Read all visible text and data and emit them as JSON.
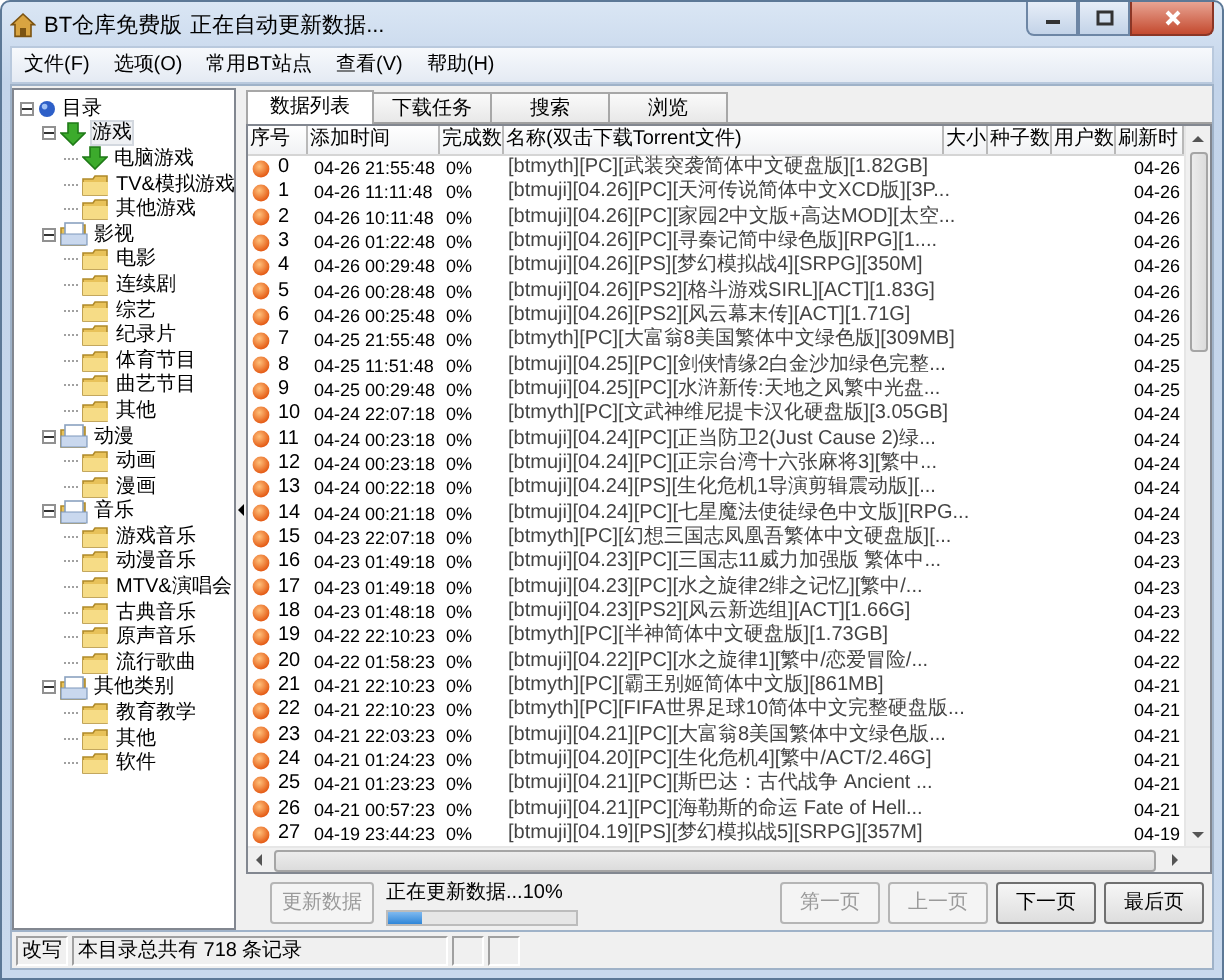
{
  "window": {
    "title": "BT仓库免费版",
    "subtitle": "正在自动更新数据..."
  },
  "menu": [
    {
      "label": "文件(F)"
    },
    {
      "label": "选项(O)"
    },
    {
      "label": "常用BT站点"
    },
    {
      "label": "查看(V)"
    },
    {
      "label": "帮助(H)"
    }
  ],
  "tree": {
    "label": "目录",
    "kind": "root",
    "expanded": true,
    "selected": false,
    "children": [
      {
        "label": "游戏",
        "kind": "download",
        "expanded": true,
        "selected": true,
        "children": [
          {
            "label": "电脑游戏",
            "kind": "download",
            "selected": false
          },
          {
            "label": "TV&模拟游戏",
            "kind": "folder",
            "selected": false
          },
          {
            "label": "其他游戏",
            "kind": "folder",
            "selected": false
          }
        ]
      },
      {
        "label": "影视",
        "kind": "category",
        "expanded": true,
        "selected": false,
        "children": [
          {
            "label": "电影",
            "kind": "folder",
            "selected": false
          },
          {
            "label": "连续剧",
            "kind": "folder",
            "selected": false
          },
          {
            "label": "综艺",
            "kind": "folder",
            "selected": false
          },
          {
            "label": "纪录片",
            "kind": "folder",
            "selected": false
          },
          {
            "label": "体育节目",
            "kind": "folder",
            "selected": false
          },
          {
            "label": "曲艺节目",
            "kind": "folder",
            "selected": false
          },
          {
            "label": "其他",
            "kind": "folder",
            "selected": false
          }
        ]
      },
      {
        "label": "动漫",
        "kind": "category",
        "expanded": true,
        "selected": false,
        "children": [
          {
            "label": "动画",
            "kind": "folder",
            "selected": false
          },
          {
            "label": "漫画",
            "kind": "folder",
            "selected": false
          }
        ]
      },
      {
        "label": "音乐",
        "kind": "category",
        "expanded": true,
        "selected": false,
        "children": [
          {
            "label": "游戏音乐",
            "kind": "folder",
            "selected": false
          },
          {
            "label": "动漫音乐",
            "kind": "folder",
            "selected": false
          },
          {
            "label": "MTV&演唱会",
            "kind": "folder",
            "selected": false
          },
          {
            "label": "古典音乐",
            "kind": "folder",
            "selected": false
          },
          {
            "label": "原声音乐",
            "kind": "folder",
            "selected": false
          },
          {
            "label": "流行歌曲",
            "kind": "folder",
            "selected": false
          }
        ]
      },
      {
        "label": "其他类别",
        "kind": "category",
        "expanded": true,
        "selected": false,
        "children": [
          {
            "label": "教育教学",
            "kind": "folder",
            "selected": false
          },
          {
            "label": "其他",
            "kind": "folder",
            "selected": false
          },
          {
            "label": "软件",
            "kind": "folder",
            "selected": false
          }
        ]
      }
    ]
  },
  "tabs": [
    {
      "label": "数据列表",
      "selected": true
    },
    {
      "label": "下载任务",
      "selected": false
    },
    {
      "label": "搜索",
      "selected": false
    },
    {
      "label": "浏览",
      "selected": false
    }
  ],
  "table": {
    "columns": [
      "序号",
      "添加时间",
      "完成数",
      "名称(双击下载Torrent文件)",
      "大小",
      "种子数",
      "用户数",
      "刷新时"
    ],
    "rows": [
      {
        "no": "0",
        "added": "04-26 21:55:48",
        "done": "0%",
        "name": "[btmyth][PC][武装突袭简体中文硬盘版][1.82GB]",
        "refreshed": "04-26"
      },
      {
        "no": "1",
        "added": "04-26 11:11:48",
        "done": "0%",
        "name": "[btmuji][04.26][PC][天河传说简体中文XCD版][3P...",
        "refreshed": "04-26"
      },
      {
        "no": "2",
        "added": "04-26 10:11:48",
        "done": "0%",
        "name": "[btmuji][04.26][PC][家园2中文版+高达MOD][太空...",
        "refreshed": "04-26"
      },
      {
        "no": "3",
        "added": "04-26 01:22:48",
        "done": "0%",
        "name": "[btmuji][04.26][PC][寻秦记简中绿色版][RPG][1....",
        "refreshed": "04-26"
      },
      {
        "no": "4",
        "added": "04-26 00:29:48",
        "done": "0%",
        "name": "[btmuji][04.26][PS][梦幻模拟战4][SRPG][350M]",
        "refreshed": "04-26"
      },
      {
        "no": "5",
        "added": "04-26 00:28:48",
        "done": "0%",
        "name": "[btmuji][04.26][PS2][格斗游戏SIRL][ACT][1.83G]",
        "refreshed": "04-26"
      },
      {
        "no": "6",
        "added": "04-26 00:25:48",
        "done": "0%",
        "name": "[btmuji][04.26][PS2][风云幕末传][ACT][1.71G]",
        "refreshed": "04-26"
      },
      {
        "no": "7",
        "added": "04-25 21:55:48",
        "done": "0%",
        "name": "[btmyth][PC][大富翁8美国繁体中文绿色版][309MB]",
        "refreshed": "04-25"
      },
      {
        "no": "8",
        "added": "04-25 11:51:48",
        "done": "0%",
        "name": "[btmuji][04.25][PC][剑侠情缘2白金沙加绿色完整...",
        "refreshed": "04-25"
      },
      {
        "no": "9",
        "added": "04-25 00:29:48",
        "done": "0%",
        "name": "[btmuji][04.25][PC][水浒新传:天地之风繁中光盘...",
        "refreshed": "04-25"
      },
      {
        "no": "10",
        "added": "04-24 22:07:18",
        "done": "0%",
        "name": "[btmyth][PC][文武神维尼提卡汉化硬盘版][3.05GB]",
        "refreshed": "04-24"
      },
      {
        "no": "11",
        "added": "04-24 00:23:18",
        "done": "0%",
        "name": "[btmuji][04.24][PC][正当防卫2(Just Cause 2)绿...",
        "refreshed": "04-24"
      },
      {
        "no": "12",
        "added": "04-24 00:23:18",
        "done": "0%",
        "name": "[btmuji][04.24][PC][正宗台湾十六张麻将3][繁中...",
        "refreshed": "04-24"
      },
      {
        "no": "13",
        "added": "04-24 00:22:18",
        "done": "0%",
        "name": "[btmuji][04.24][PS][生化危机1导演剪辑震动版][...",
        "refreshed": "04-24"
      },
      {
        "no": "14",
        "added": "04-24 00:21:18",
        "done": "0%",
        "name": "[btmuji][04.24][PC][七星魔法使徒绿色中文版][RPG...",
        "refreshed": "04-24"
      },
      {
        "no": "15",
        "added": "04-23 22:07:18",
        "done": "0%",
        "name": "[btmyth][PC][幻想三国志凤凰吾繁体中文硬盘版][...",
        "refreshed": "04-23"
      },
      {
        "no": "16",
        "added": "04-23 01:49:18",
        "done": "0%",
        "name": "[btmuji][04.23][PC][三国志11威力加强版 繁体中...",
        "refreshed": "04-23"
      },
      {
        "no": "17",
        "added": "04-23 01:49:18",
        "done": "0%",
        "name": "[btmuji][04.23][PC][水之旋律2绯之记忆][繁中/...",
        "refreshed": "04-23"
      },
      {
        "no": "18",
        "added": "04-23 01:48:18",
        "done": "0%",
        "name": "[btmuji][04.23][PS2][风云新选组][ACT][1.66G]",
        "refreshed": "04-23"
      },
      {
        "no": "19",
        "added": "04-22 22:10:23",
        "done": "0%",
        "name": "[btmyth][PC][半神简体中文硬盘版][1.73GB]",
        "refreshed": "04-22"
      },
      {
        "no": "20",
        "added": "04-22 01:58:23",
        "done": "0%",
        "name": "[btmuji][04.22][PC][水之旋律1][繁中/恋爱冒险/...",
        "refreshed": "04-22"
      },
      {
        "no": "21",
        "added": "04-21 22:10:23",
        "done": "0%",
        "name": "[btmyth][PC][霸王别姬简体中文版][861MB]",
        "refreshed": "04-21"
      },
      {
        "no": "22",
        "added": "04-21 22:10:23",
        "done": "0%",
        "name": "[btmyth][PC][FIFA世界足球10简体中文完整硬盘版...",
        "refreshed": "04-21"
      },
      {
        "no": "23",
        "added": "04-21 22:03:23",
        "done": "0%",
        "name": "[btmuji][04.21][PC][大富翁8美国繁体中文绿色版...",
        "refreshed": "04-21"
      },
      {
        "no": "24",
        "added": "04-21 01:24:23",
        "done": "0%",
        "name": "[btmuji][04.20][PC][生化危机4][繁中/ACT/2.46G]",
        "refreshed": "04-21"
      },
      {
        "no": "25",
        "added": "04-21 01:23:23",
        "done": "0%",
        "name": "[btmuji][04.21][PC][斯巴达：古代战争 Ancient ...",
        "refreshed": "04-21"
      },
      {
        "no": "26",
        "added": "04-21 00:57:23",
        "done": "0%",
        "name": "[btmuji][04.21][PC][海勒斯的命运 Fate of Hell...",
        "refreshed": "04-21"
      },
      {
        "no": "27",
        "added": "04-19 23:44:23",
        "done": "0%",
        "name": "[btmuji][04.19][PS][梦幻模拟战5][SRPG][357M]",
        "refreshed": "04-19"
      }
    ]
  },
  "update_button": {
    "label": "更新数据",
    "disabled": true
  },
  "progress": {
    "text": "正在更新数据...10%",
    "level": 0.18
  },
  "pager": [
    {
      "label": "第一页",
      "disabled": true
    },
    {
      "label": "上一页",
      "disabled": true
    },
    {
      "label": "下一页",
      "disabled": false
    },
    {
      "label": "最后页",
      "disabled": false
    }
  ],
  "status_bar": {
    "mode": "改写",
    "message": "本目录总共有 718 条记录"
  }
}
